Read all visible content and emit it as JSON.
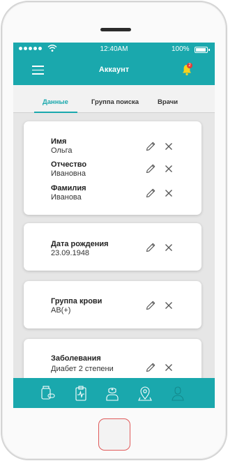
{
  "status_bar": {
    "time": "12:40AM",
    "battery": "100%"
  },
  "header": {
    "title": "Аккаунт",
    "notification_count": "2"
  },
  "tabs": [
    {
      "label": "Данные",
      "active": true
    },
    {
      "label": "Группа поиска",
      "active": false
    },
    {
      "label": "Врачи",
      "active": false
    }
  ],
  "cards": [
    {
      "fields": [
        {
          "label": "Имя",
          "value": "Ольга"
        },
        {
          "label": "Отчество",
          "value": "Ивановна"
        },
        {
          "label": "Фамилия",
          "value": "Иванова"
        }
      ]
    },
    {
      "fields": [
        {
          "label": "Дата рождения",
          "value": "23.09.1948"
        }
      ]
    },
    {
      "fields": [
        {
          "label": "Группа крови",
          "value": "AB(+)"
        }
      ]
    },
    {
      "fields": [
        {
          "label": "Заболевания",
          "value": "Диабет 2 степени"
        }
      ]
    }
  ],
  "bottom_nav": [
    "medicine-icon",
    "medical-chart-icon",
    "doctor-icon",
    "location-pin-icon",
    "profile-icon"
  ],
  "colors": {
    "accent": "#1aa8ad",
    "badge": "#e53935",
    "background": "#e6e6e6"
  }
}
